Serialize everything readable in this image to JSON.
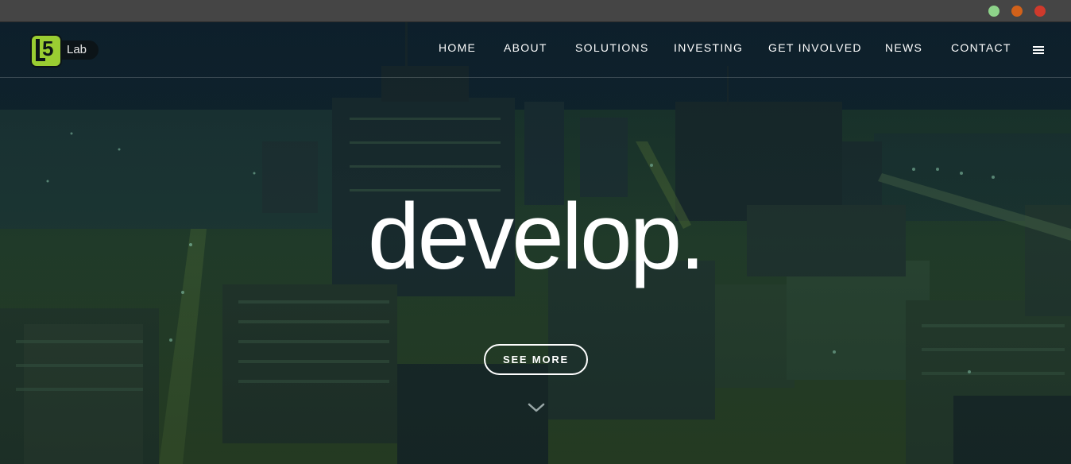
{
  "window": {
    "controls": [
      {
        "name": "maximize",
        "color": "#8ed38a"
      },
      {
        "name": "minimize",
        "color": "#d1611a"
      },
      {
        "name": "close",
        "color": "#cf3a2c"
      }
    ]
  },
  "brand": {
    "badge_text": "5",
    "pill_text": "Lab",
    "accent_color": "#9acd32"
  },
  "nav": {
    "items": [
      {
        "label": "HOME"
      },
      {
        "label": "ABOUT"
      },
      {
        "label": "SOLUTIONS"
      },
      {
        "label": "INVESTING"
      },
      {
        "label": "GET INVOLVED"
      },
      {
        "label": "NEWS"
      },
      {
        "label": "CONTACT"
      }
    ],
    "menu_icon": "hamburger-icon"
  },
  "hero": {
    "headline": "develop.",
    "cta_label": "SEE MORE",
    "scroll_icon": "chevron-down-icon"
  }
}
